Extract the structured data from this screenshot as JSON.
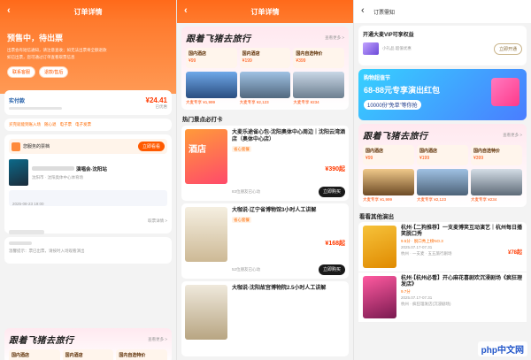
{
  "panel1": {
    "title": "订单详情",
    "status_title": "预售中，待出票",
    "status_desc1": "出票会有短信通知，请注意查收；如无法出票将全额退款",
    "status_desc2": "如已出票，您可通过订单查看取票信息",
    "btn_left": "联系客服",
    "btn_right": "退款/售后",
    "price_label": "实付款",
    "price": "¥24.41",
    "price_note": "已优惠",
    "tags": [
      "买完就能到账入场",
      "随心退",
      "电子票",
      "电子发票"
    ],
    "ticket_label": "您服务的票档",
    "ticket_btn": "立即看看",
    "event_name": "演唱会-沈阳站",
    "event_sub": "沈阳市 · 沈阳奥体中心体育场",
    "event_date": "2025-08-23 19:00",
    "section_link": "取票详情 >",
    "note_text": "温馨提示：票已出票，请按时入场观看演出"
  },
  "promo": {
    "title": "跟着飞猪去旅行",
    "more": "查看更多 >",
    "tiles": [
      {
        "label": "国内酒店",
        "price": "¥99"
      },
      {
        "label": "国内酒店",
        "price": "¥199"
      },
      {
        "label": "国内自选特价",
        "price": "¥399"
      }
    ],
    "hotels": [
      {
        "caption": "大麦专享 ¥1,999"
      },
      {
        "caption": "大麦专享 ¥2,123"
      },
      {
        "caption": "大麦专享 ¥234"
      }
    ]
  },
  "panel2": {
    "title": "订单详情",
    "hot_section": "热门景点必打卡",
    "items": [
      {
        "title": "大麦乐途省心包-沈阳奥体中心周边｜沈阳云湾酒店（奥体中心店）",
        "chip1": "省心套餐",
        "chip2": "",
        "price": "¥390起",
        "likes": "83位朋友已心动",
        "cta": "立即购买"
      },
      {
        "title": "大咖说-辽宁省博物馆3小时人工讲解",
        "chip1": "省心套餐",
        "chip2": "",
        "price": "¥168起",
        "likes": "52位朋友已心动",
        "cta": "立即购买"
      },
      {
        "title": "大咖说-沈阳故宫博物院2.5小时人工讲解",
        "chip1": "",
        "chip2": "",
        "price": "",
        "likes": "",
        "cta": ""
      }
    ]
  },
  "panel3": {
    "title": "订票需知",
    "vip_title": "开通大麦VIP可享权益",
    "vip_btn": "立即开通",
    "vip_item": "小礼品 超值优惠",
    "banner_top": "购物超值节",
    "banner_main": "68-88元专享演出红包",
    "banner_sub": "10000份“免单”等你抢",
    "other_section": "看看其他演出",
    "shows": [
      {
        "title": "杭州·【二狗推荐】一支麦博笑互动演艺｜杭州每日播笑脱口秀",
        "score": "9.5分 · 脱口秀上榜NO.3",
        "date": "2025.07.17-07.31",
        "venue": "杭州 · 一支麦 · 五五旅行剧场",
        "price": "¥78起"
      },
      {
        "title": "杭州·【杭州必看】开心麻花喜剧欢沉浸剧场《疯狂理发店》",
        "score": "9.7分",
        "date": "2025.07.17-07.31",
        "venue": "杭州 · 疯狂理发店(沉浸剧场)",
        "price": ""
      }
    ],
    "watermark": "php中文网"
  },
  "colors": {
    "accent": "#ff5a00",
    "header": "#ff6a1a",
    "price": "#ff3a00"
  }
}
